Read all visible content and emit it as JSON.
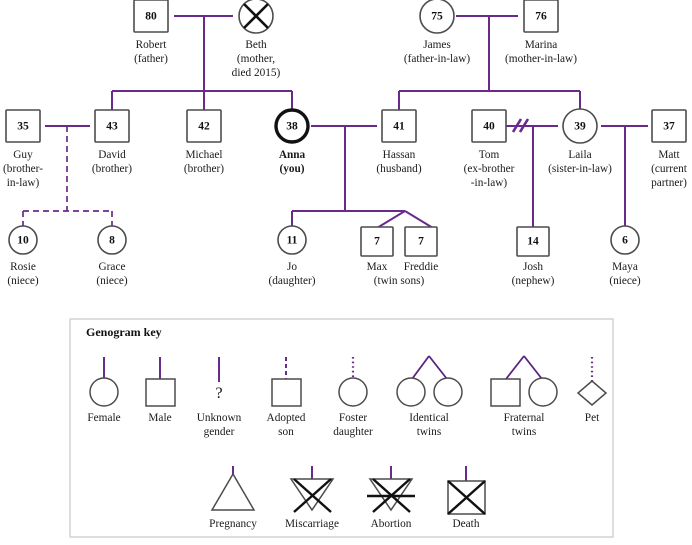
{
  "colors": {
    "connector": "#6a2a8c",
    "shape_stroke": "#4c4c4c",
    "self_stroke": "#111111",
    "text": "#1a1a1a",
    "key_border": "#c8c8c8",
    "background": "#ffffff"
  },
  "people": {
    "robert": {
      "age": "80",
      "name": "Robert",
      "relation": "(father)"
    },
    "beth": {
      "age": "",
      "name": "Beth",
      "relation": "(mother,",
      "relation2": "died 2015)"
    },
    "james": {
      "age": "75",
      "name": "James",
      "relation": "(father-in-law)"
    },
    "marina": {
      "age": "76",
      "name": "Marina",
      "relation": "(mother-in-law)"
    },
    "guy": {
      "age": "35",
      "name": "Guy",
      "relation": "(brother-",
      "relation2": "in-law)"
    },
    "david": {
      "age": "43",
      "name": "David",
      "relation": "(brother)"
    },
    "michael": {
      "age": "42",
      "name": "Michael",
      "relation": "(brother)"
    },
    "anna": {
      "age": "38",
      "name": "Anna",
      "relation": "(you)"
    },
    "hassan": {
      "age": "41",
      "name": "Hassan",
      "relation": "(husband)"
    },
    "tom": {
      "age": "40",
      "name": "Tom",
      "relation": "(ex-brother",
      "relation2": "-in-law)"
    },
    "laila": {
      "age": "39",
      "name": "Laila",
      "relation": "(sister-in-law)"
    },
    "matt": {
      "age": "37",
      "name": "Matt",
      "relation": "(current",
      "relation2": "partner)"
    },
    "rosie": {
      "age": "10",
      "name": "Rosie",
      "relation": "(niece)"
    },
    "grace": {
      "age": "8",
      "name": "Grace",
      "relation": "(niece)"
    },
    "jo": {
      "age": "11",
      "name": "Jo",
      "relation": "(daughter)"
    },
    "max": {
      "age": "7",
      "name": "Max",
      "relation": ""
    },
    "freddie": {
      "age": "7",
      "name": "Freddie",
      "relation": "(twin sons)"
    },
    "josh": {
      "age": "14",
      "name": "Josh",
      "relation": "(nephew)"
    },
    "maya": {
      "age": "6",
      "name": "Maya",
      "relation": "(niece)"
    }
  },
  "key": {
    "title": "Genogram key",
    "items_row1": [
      {
        "id": "female",
        "label": "Female",
        "label2": ""
      },
      {
        "id": "male",
        "label": "Male",
        "label2": ""
      },
      {
        "id": "unknown",
        "label": "Unknown",
        "label2": "gender"
      },
      {
        "id": "adopted-son",
        "label": "Adopted",
        "label2": "son"
      },
      {
        "id": "foster-daughter",
        "label": "Foster",
        "label2": "daughter"
      },
      {
        "id": "identical-twins",
        "label": "Identical",
        "label2": "twins"
      },
      {
        "id": "fraternal-twins",
        "label": "Fraternal",
        "label2": "twins"
      },
      {
        "id": "pet",
        "label": "Pet",
        "label2": ""
      }
    ],
    "items_row2": [
      {
        "id": "pregnancy",
        "label": "Pregnancy",
        "label2": ""
      },
      {
        "id": "miscarriage",
        "label": "Miscarriage",
        "label2": ""
      },
      {
        "id": "abortion",
        "label": "Abortion",
        "label2": ""
      },
      {
        "id": "death",
        "label": "Death",
        "label2": ""
      }
    ],
    "unknown_glyph": "?"
  },
  "chart_data": {
    "type": "diagram",
    "title": "Family genogram",
    "generations": [
      {
        "level": 1,
        "members": [
          "Robert",
          "Beth",
          "James",
          "Marina"
        ]
      },
      {
        "level": 2,
        "members": [
          "Guy",
          "David",
          "Michael",
          "Anna",
          "Hassan",
          "Tom",
          "Laila",
          "Matt"
        ]
      },
      {
        "level": 3,
        "members": [
          "Rosie",
          "Grace",
          "Jo",
          "Max",
          "Freddie",
          "Josh",
          "Maya"
        ]
      }
    ],
    "unions": [
      {
        "partners": [
          "Robert",
          "Beth"
        ],
        "children": [
          "David",
          "Michael",
          "Anna"
        ],
        "status": "married"
      },
      {
        "partners": [
          "James",
          "Marina"
        ],
        "children": [
          "Hassan",
          "Laila"
        ],
        "status": "married"
      },
      {
        "partners": [
          "Guy",
          "David"
        ],
        "children": [
          "Rosie",
          "Grace"
        ],
        "status": "adoptive"
      },
      {
        "partners": [
          "Anna",
          "Hassan"
        ],
        "children": [
          "Jo",
          "Max",
          "Freddie"
        ],
        "status": "married"
      },
      {
        "partners": [
          "Tom",
          "Laila"
        ],
        "children": [
          "Josh"
        ],
        "status": "divorced"
      },
      {
        "partners": [
          "Laila",
          "Matt"
        ],
        "children": [
          "Maya"
        ],
        "status": "partners"
      }
    ],
    "twins": {
      "pair": [
        "Max",
        "Freddie"
      ],
      "type": "fraternal"
    },
    "deceased": [
      "Beth"
    ],
    "index_person": "Anna"
  }
}
